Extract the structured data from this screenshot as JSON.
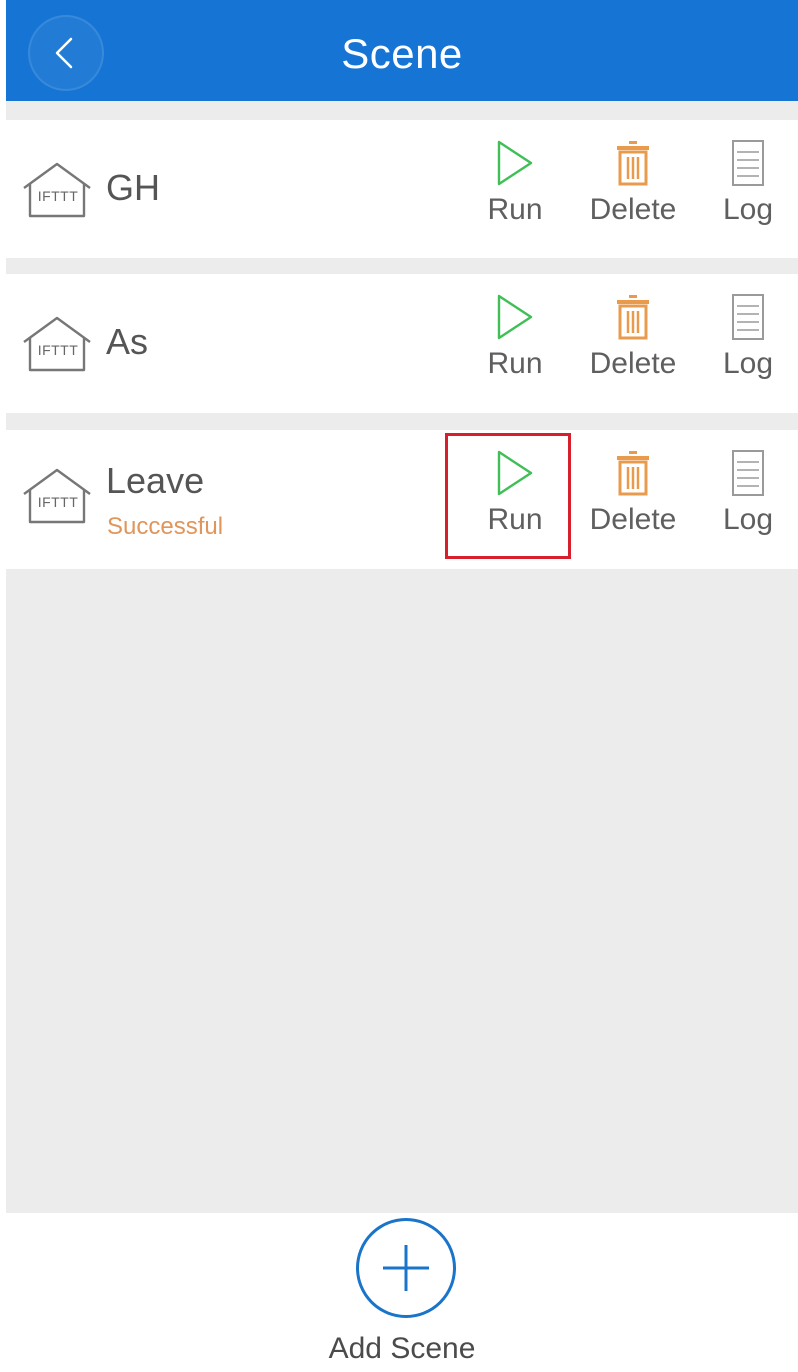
{
  "header": {
    "title": "Scene",
    "back_icon": "chevron-left-icon"
  },
  "scenes": [
    {
      "name": "GH",
      "icon_label": "IFTTT",
      "status": "",
      "actions": {
        "run": "Run",
        "delete": "Delete",
        "log": "Log"
      }
    },
    {
      "name": "As",
      "icon_label": "IFTTT",
      "status": "",
      "actions": {
        "run": "Run",
        "delete": "Delete",
        "log": "Log"
      }
    },
    {
      "name": "Leave",
      "icon_label": "IFTTT",
      "status": "Successful",
      "actions": {
        "run": "Run",
        "delete": "Delete",
        "log": "Log"
      }
    }
  ],
  "footer": {
    "add_label": "Add Scene",
    "add_icon": "plus-circle-icon"
  },
  "colors": {
    "header_bg": "#1574d4",
    "run_icon": "#3fbf56",
    "delete_icon": "#e89a4d",
    "log_icon": "#9a9a9a",
    "status_text": "#e0955a",
    "highlight": "#d81f2d",
    "add_button": "#1a74c9",
    "list_bg": "#ececec"
  }
}
